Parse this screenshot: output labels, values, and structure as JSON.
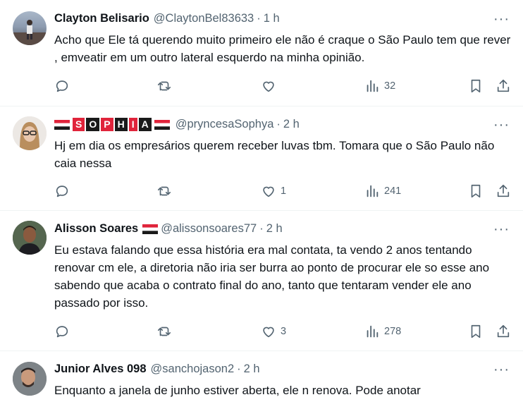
{
  "tweets": [
    {
      "name": "Clayton Belisario",
      "handle": "@ClaytonBel83633",
      "time": "1 h",
      "text": "Acho que Ele tá querendo  muito primeiro  ele não  é craque o São  Paulo tem que rever , emveatir em um outro lateral esquerdo na minha opinião.",
      "replies": "",
      "retweets": "",
      "likes": "",
      "views": "32"
    },
    {
      "name_letters": [
        "S",
        "O",
        "P",
        "H",
        "I",
        "A"
      ],
      "handle": "@pryncesaSophya",
      "time": "2 h",
      "text": "Hj em dia os empresários querem receber luvas tbm. Tomara que o São Paulo não caia nessa",
      "replies": "",
      "retweets": "",
      "likes": "1",
      "views": "241"
    },
    {
      "name": "Alisson Soares",
      "handle": "@alissonsoares77",
      "time": "2 h",
      "text": "Eu estava falando que essa história era mal contata, ta vendo 2 anos tentando renovar cm ele, a diretoria não iria ser burra ao ponto de procurar ele so esse ano sabendo que acaba o contrato final do ano, tanto que tentaram vender ele ano passado por isso.",
      "replies": "",
      "retweets": "",
      "likes": "3",
      "views": "278"
    },
    {
      "name": "Junior Alves 098",
      "handle": "@sanchojason2",
      "time": "2 h",
      "text": "Enquanto a janela de junho estiver aberta, ele n renova. Pode anotar"
    }
  ],
  "dot": "·",
  "more_label": "···",
  "colors": {
    "red": "#e0243b",
    "gray": "#536471",
    "text": "#0f1419"
  },
  "icons": [
    "reply-icon",
    "retweet-icon",
    "like-icon",
    "views-icon",
    "bookmark-icon",
    "share-icon",
    "more-icon",
    "flag-icon"
  ]
}
